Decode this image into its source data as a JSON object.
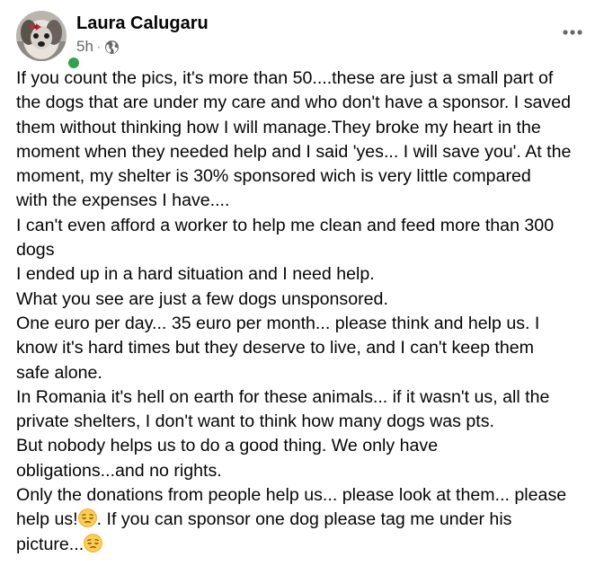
{
  "post": {
    "author": "Laura Calugaru",
    "time": "5h",
    "separator": "·",
    "visibility_icon": "globe-icon",
    "more_icon": "more-horizontal-icon",
    "online_color": "#31a24c",
    "emoji_icon": "pensive-face-emoji",
    "lines": [
      "If you count the pics, it's more than 50....these are just a small part of",
      "the dogs that are under my care and who don't have a sponsor. I saved",
      "them without thinking how I will manage.They broke my heart in the",
      "moment when they needed help and I said 'yes... I will save you'. At the",
      "moment, my shelter is 30% sponsored wich is very little compared",
      "with the expenses I have....",
      "I can't even afford a worker to help me clean and feed more than 300",
      "dogs",
      "I ended up in a hard situation and I need help.",
      "What you see are just a few dogs unsponsored.",
      "One euro per day... 35 euro per month... please think and help us. I",
      "know it's hard times but they deserve to live, and I can't keep them",
      "safe alone.",
      "In Romania it's hell on earth for these animals... if it wasn't us, all the",
      "private shelters, I don't want to think how many dogs was pts.",
      "But nobody helps us to do a good thing. We only have",
      "obligations...and no rights.",
      "Only the donations from people help us... please look at them... please"
    ],
    "line_19_before": "help us!",
    "line_19_after": ". If you can sponsor one dog please tag me under his",
    "line_20_before": "picture..."
  }
}
